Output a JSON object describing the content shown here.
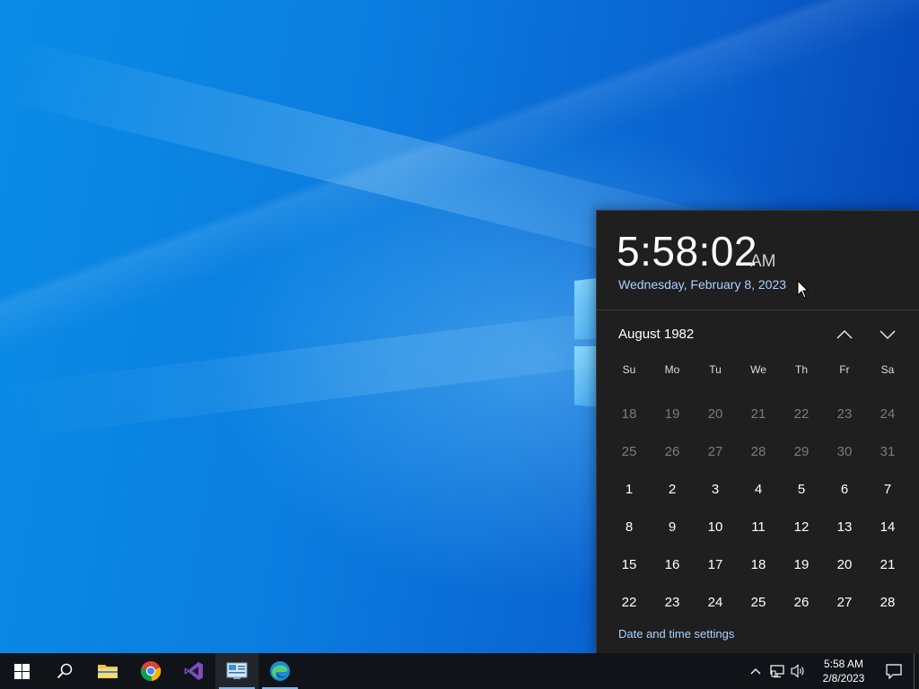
{
  "flyout": {
    "time": "5:58:02",
    "ampm": "AM",
    "full_date": "Wednesday, February 8, 2023",
    "month_label": "August 1982",
    "weekdays": [
      "Su",
      "Mo",
      "Tu",
      "We",
      "Th",
      "Fr",
      "Sa"
    ],
    "weeks": [
      [
        {
          "d": "18",
          "other": true
        },
        {
          "d": "19",
          "other": true
        },
        {
          "d": "20",
          "other": true
        },
        {
          "d": "21",
          "other": true
        },
        {
          "d": "22",
          "other": true
        },
        {
          "d": "23",
          "other": true
        },
        {
          "d": "24",
          "other": true
        }
      ],
      [
        {
          "d": "25",
          "other": true
        },
        {
          "d": "26",
          "other": true
        },
        {
          "d": "27",
          "other": true
        },
        {
          "d": "28",
          "other": true
        },
        {
          "d": "29",
          "other": true
        },
        {
          "d": "30",
          "other": true
        },
        {
          "d": "31",
          "other": true
        }
      ],
      [
        {
          "d": "1"
        },
        {
          "d": "2"
        },
        {
          "d": "3"
        },
        {
          "d": "4"
        },
        {
          "d": "5"
        },
        {
          "d": "6"
        },
        {
          "d": "7"
        }
      ],
      [
        {
          "d": "8"
        },
        {
          "d": "9"
        },
        {
          "d": "10"
        },
        {
          "d": "11"
        },
        {
          "d": "12"
        },
        {
          "d": "13"
        },
        {
          "d": "14"
        }
      ],
      [
        {
          "d": "15"
        },
        {
          "d": "16"
        },
        {
          "d": "17"
        },
        {
          "d": "18"
        },
        {
          "d": "19"
        },
        {
          "d": "20"
        },
        {
          "d": "21"
        }
      ],
      [
        {
          "d": "22"
        },
        {
          "d": "23"
        },
        {
          "d": "24"
        },
        {
          "d": "25"
        },
        {
          "d": "26"
        },
        {
          "d": "27"
        },
        {
          "d": "28"
        }
      ]
    ],
    "settings_link": "Date and time settings",
    "nav_up_icon": "chevron-up-icon",
    "nav_down_icon": "chevron-down-icon"
  },
  "taskbar": {
    "apps": [
      {
        "name": "start-button",
        "icon": "windows-logo-icon"
      },
      {
        "name": "search-button",
        "icon": "search-icon"
      },
      {
        "name": "file-explorer-button",
        "icon": "folder-icon"
      },
      {
        "name": "chrome-button",
        "icon": "chrome-icon"
      },
      {
        "name": "visual-studio-button",
        "icon": "visual-studio-icon"
      },
      {
        "name": "control-panel-button",
        "icon": "control-panel-icon"
      },
      {
        "name": "edge-button",
        "icon": "edge-icon"
      }
    ],
    "tray": {
      "time": "5:58 AM",
      "date": "2/8/2023"
    }
  },
  "colors": {
    "flyout_bg": "#1f1f1f",
    "accent_link": "#a8d3ff",
    "taskbar_bg": "#101418"
  }
}
